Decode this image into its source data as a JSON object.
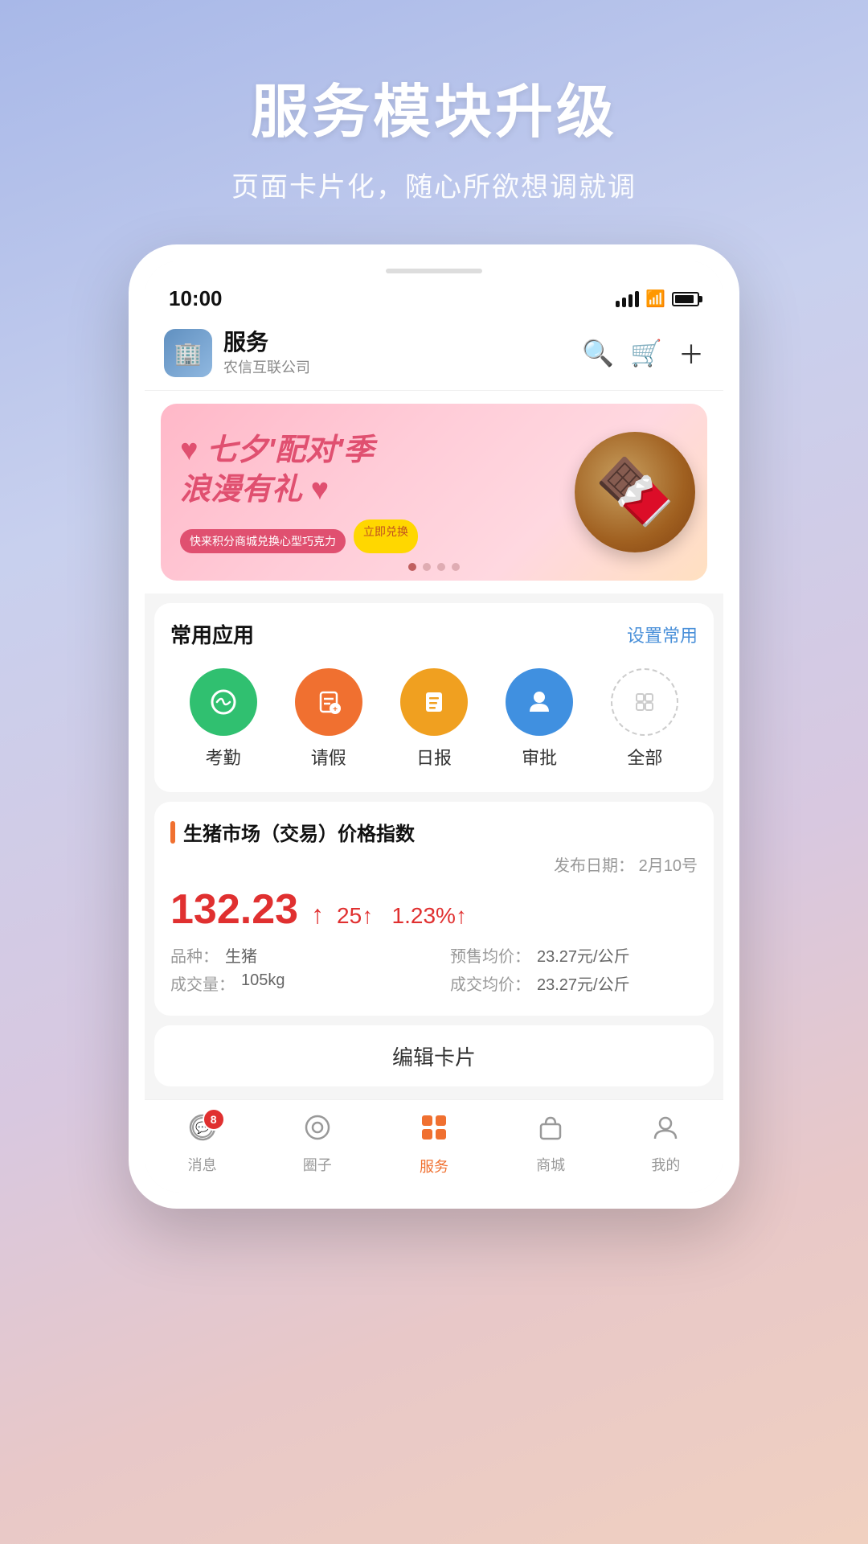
{
  "page": {
    "title": "服务模块升级",
    "subtitle": "页面卡片化，随心所欲想调就调",
    "background_gradient": "linear-gradient(160deg, #a8b8e8, #d8c8e0, #f0d0c0)"
  },
  "status_bar": {
    "time": "10:00",
    "location_icon": "▶",
    "signal": "4 bars",
    "wifi": "wifi",
    "battery": "full"
  },
  "app_header": {
    "logo_emoji": "🏢",
    "app_name": "服务",
    "company": "农信互联公司",
    "search_label": "搜索",
    "cart_label": "购物车",
    "add_label": "添加"
  },
  "banner": {
    "title_line1": "七夕'配对'季",
    "title_line2": "浪漫有礼",
    "heart_left": "♥",
    "heart_right": "♥",
    "sub_text": "快来积分商城兑换心型巧克力",
    "sub_action": "立即兑换",
    "image_emoji": "🍫",
    "dots": [
      {
        "active": true
      },
      {
        "active": false
      },
      {
        "active": false
      },
      {
        "active": false
      }
    ]
  },
  "common_apps": {
    "section_title": "常用应用",
    "action_label": "设置常用",
    "apps": [
      {
        "name": "考勤",
        "icon_color": "green",
        "icon": "⊙"
      },
      {
        "name": "请假",
        "icon_color": "orange",
        "icon": "📋"
      },
      {
        "name": "日报",
        "icon_color": "amber",
        "icon": "📄"
      },
      {
        "name": "审批",
        "icon_color": "blue",
        "icon": "👤"
      },
      {
        "name": "全部",
        "icon_color": "outline",
        "icon": "⊞"
      }
    ]
  },
  "market_card": {
    "indicator_color": "#f07030",
    "title": "生猪市场（交易）价格指数",
    "publish_label": "发布日期：",
    "publish_date": "2月10号",
    "price_main": "132.23",
    "price_up_arrow": "↑",
    "price_change": "25↑",
    "price_pct": "1.23%↑",
    "detail_left": [
      {
        "label": "品种：",
        "value": "生猪"
      },
      {
        "label": "成交量：",
        "value": "105kg"
      }
    ],
    "detail_right": [
      {
        "label": "预售均价：",
        "value": "23.27元/公斤"
      },
      {
        "label": "成交均价：",
        "value": "23.27元/公斤"
      }
    ]
  },
  "edit_card": {
    "label": "编辑卡片"
  },
  "bottom_nav": {
    "items": [
      {
        "name": "messages",
        "label": "消息",
        "icon": "💬",
        "active": false,
        "badge": "8"
      },
      {
        "name": "circle",
        "label": "圈子",
        "icon": "⊙",
        "active": false,
        "badge": null
      },
      {
        "name": "service",
        "label": "服务",
        "icon": "⊞",
        "active": true,
        "badge": null
      },
      {
        "name": "shop",
        "label": "商城",
        "icon": "🛍",
        "active": false,
        "badge": null
      },
      {
        "name": "mine",
        "label": "我的",
        "icon": "👤",
        "active": false,
        "badge": null
      }
    ]
  }
}
